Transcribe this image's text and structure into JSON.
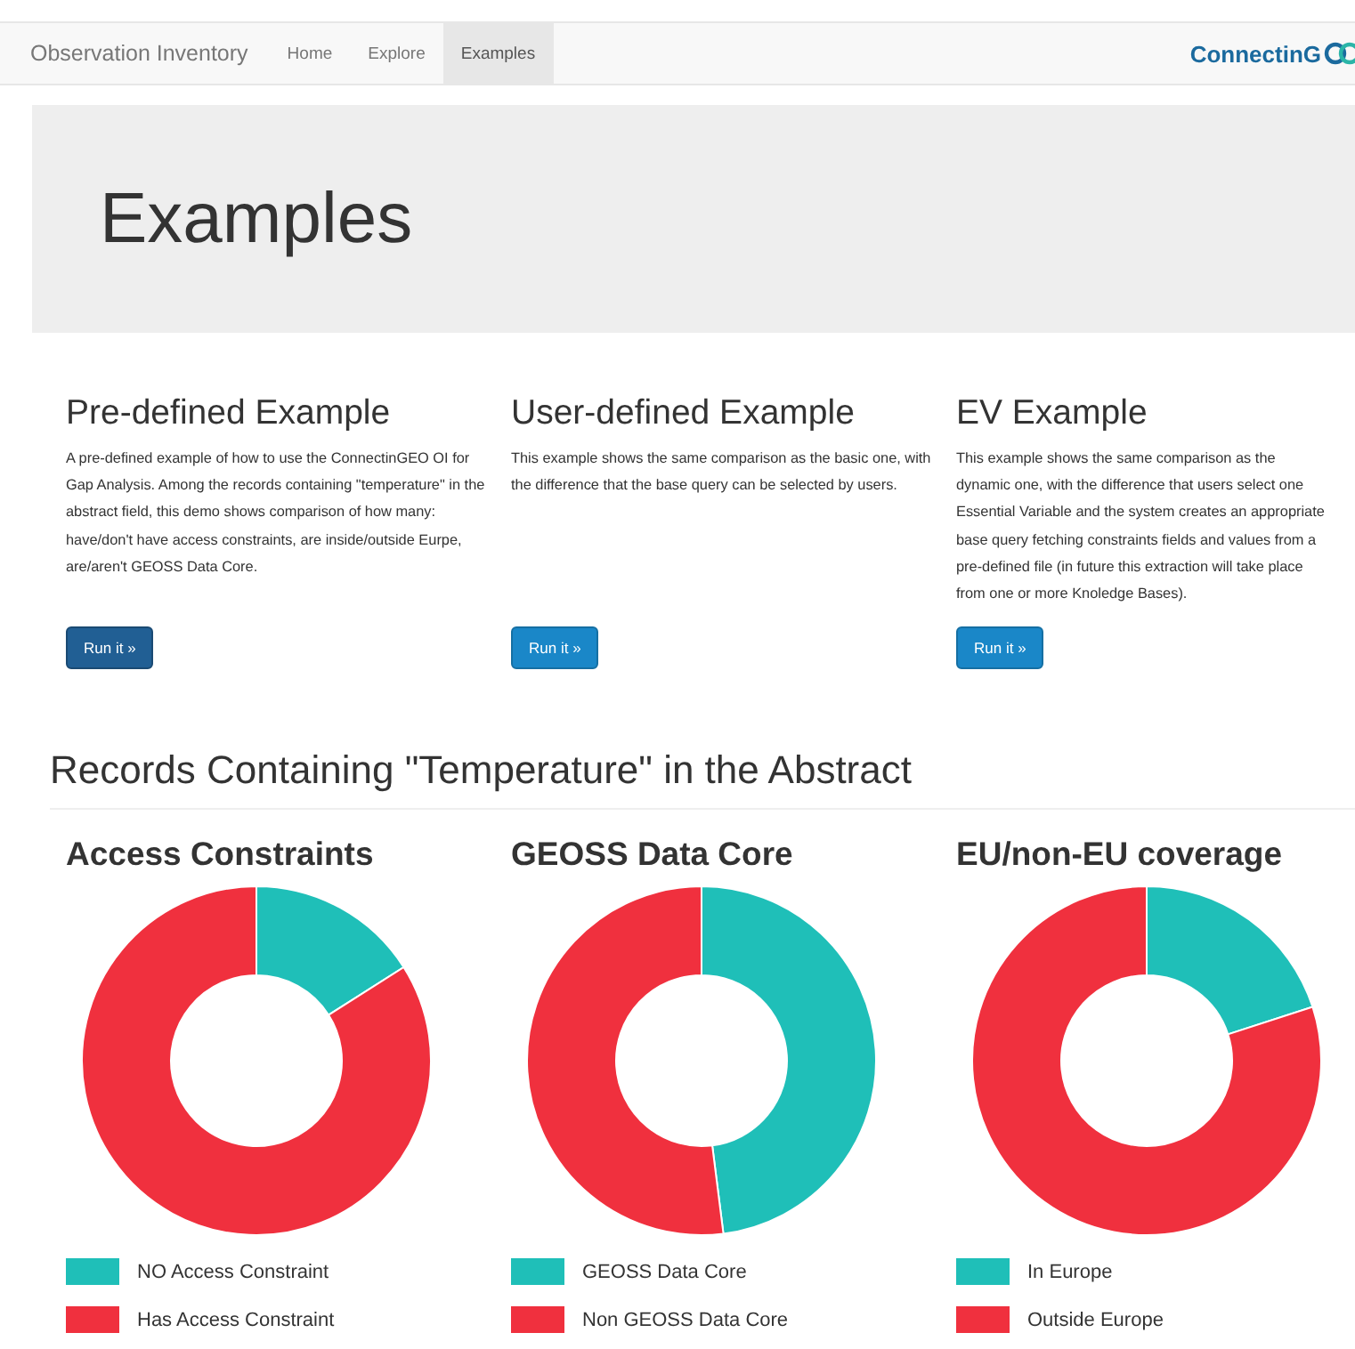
{
  "navbar": {
    "brand": "Observation Inventory",
    "links": [
      {
        "label": "Home",
        "selected": false
      },
      {
        "label": "Explore",
        "selected": false
      },
      {
        "label": "Examples",
        "selected": true
      }
    ],
    "logo": "ConnectinG"
  },
  "jumbotron": {
    "title": "Examples"
  },
  "examples": [
    {
      "title": "Pre-defined Example",
      "text": "A pre-defined example of how to use the ConnectinGEO OI for Gap Analysis. Among the records containing \"temperature\" in the abstract field, this demo shows comparison of how many: have/don't have access constraints, are inside/outside Eurpe, are/aren't GEOSS Data Core.",
      "button": "Run it »",
      "selected": true
    },
    {
      "title": "User-defined Example",
      "text": "This example shows the same comparison as the basic one, with the difference that the base query can be selected by users.",
      "button": "Run it »",
      "selected": false
    },
    {
      "title": "EV Example",
      "text": "This example shows the same comparison as the dynamic one, with the difference that users select one Essential Variable and the system creates an appropriate base query fetching constraints fields and values from a pre-defined file (in future this extraction will take place from one or more Knoledge Bases).",
      "button": "Run it »",
      "selected": false
    }
  ],
  "section_title": "Records Containing \"Temperature\" in the Abstract",
  "charts": [
    {
      "chart_data": {
        "type": "donut",
        "title": "Access Constraints",
        "categories": [
          "NO Access Constraint",
          "Has Access Constraint"
        ],
        "values": [
          16,
          84
        ],
        "colors": [
          "#1fbfb8",
          "#f0303e"
        ],
        "legend": "bottom"
      }
    },
    {
      "chart_data": {
        "type": "donut",
        "title": "GEOSS Data Core",
        "categories": [
          "GEOSS Data Core",
          "Non GEOSS Data Core"
        ],
        "values": [
          48,
          52
        ],
        "colors": [
          "#1fbfb8",
          "#f0303e"
        ],
        "legend": "bottom"
      }
    },
    {
      "chart_data": {
        "type": "donut",
        "title": "EU/non-EU coverage",
        "categories": [
          "In Europe",
          "Outside Europe"
        ],
        "values": [
          20,
          80
        ],
        "colors": [
          "#1fbfb8",
          "#f0303e"
        ],
        "legend": "bottom"
      }
    }
  ]
}
